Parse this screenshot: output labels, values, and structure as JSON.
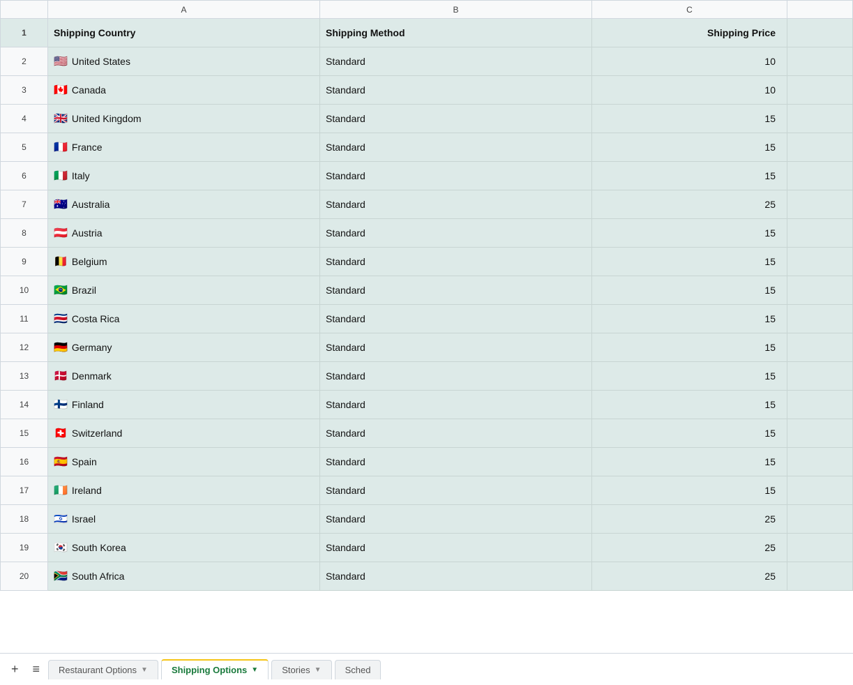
{
  "columns": {
    "row_num": "",
    "a": "A",
    "b": "B",
    "c": "C",
    "extra": ""
  },
  "headers": {
    "col_a": "Shipping Country",
    "col_b": "Shipping Method",
    "col_c": "Shipping Price"
  },
  "rows": [
    {
      "num": 2,
      "flag": "🇺🇸",
      "country": "United States",
      "method": "Standard",
      "price": "10"
    },
    {
      "num": 3,
      "flag": "🇨🇦",
      "country": "Canada",
      "method": "Standard",
      "price": "10"
    },
    {
      "num": 4,
      "flag": "🇬🇧",
      "country": "United Kingdom",
      "method": "Standard",
      "price": "15"
    },
    {
      "num": 5,
      "flag": "🇫🇷",
      "country": "France",
      "method": "Standard",
      "price": "15"
    },
    {
      "num": 6,
      "flag": "🇮🇹",
      "country": "Italy",
      "method": "Standard",
      "price": "15"
    },
    {
      "num": 7,
      "flag": "🇦🇺",
      "country": "Australia",
      "method": "Standard",
      "price": "25"
    },
    {
      "num": 8,
      "flag": "🇦🇹",
      "country": "Austria",
      "method": "Standard",
      "price": "15"
    },
    {
      "num": 9,
      "flag": "🇧🇪",
      "country": "Belgium",
      "method": "Standard",
      "price": "15"
    },
    {
      "num": 10,
      "flag": "🇧🇷",
      "country": "Brazil",
      "method": "Standard",
      "price": "15"
    },
    {
      "num": 11,
      "flag": "🇨🇷",
      "country": "Costa Rica",
      "method": "Standard",
      "price": "15"
    },
    {
      "num": 12,
      "flag": "🇩🇪",
      "country": "Germany",
      "method": "Standard",
      "price": "15"
    },
    {
      "num": 13,
      "flag": "🇩🇰",
      "country": "Denmark",
      "method": "Standard",
      "price": "15"
    },
    {
      "num": 14,
      "flag": "🇫🇮",
      "country": "Finland",
      "method": "Standard",
      "price": "15"
    },
    {
      "num": 15,
      "flag": "🇨🇭",
      "country": "Switzerland",
      "method": "Standard",
      "price": "15"
    },
    {
      "num": 16,
      "flag": "🇪🇸",
      "country": "Spain",
      "method": "Standard",
      "price": "15"
    },
    {
      "num": 17,
      "flag": "🇮🇪",
      "country": "Ireland",
      "method": "Standard",
      "price": "15"
    },
    {
      "num": 18,
      "flag": "🇮🇱",
      "country": "Israel",
      "method": "Standard",
      "price": "25"
    },
    {
      "num": 19,
      "flag": "🇰🇷",
      "country": "South Korea",
      "method": "Standard",
      "price": "25"
    },
    {
      "num": 20,
      "flag": "🇿🇦",
      "country": "South Africa",
      "method": "Standard",
      "price": "25"
    }
  ],
  "tabs": [
    {
      "id": "add-btn",
      "label": "+",
      "type": "button"
    },
    {
      "id": "menu-btn",
      "label": "≡",
      "type": "button"
    },
    {
      "id": "restaurant-options",
      "label": "Restaurant Options",
      "active": false
    },
    {
      "id": "shipping-options",
      "label": "Shipping Options",
      "active": true
    },
    {
      "id": "stories",
      "label": "Stories",
      "active": false
    },
    {
      "id": "sched",
      "label": "Sched",
      "active": false
    }
  ]
}
